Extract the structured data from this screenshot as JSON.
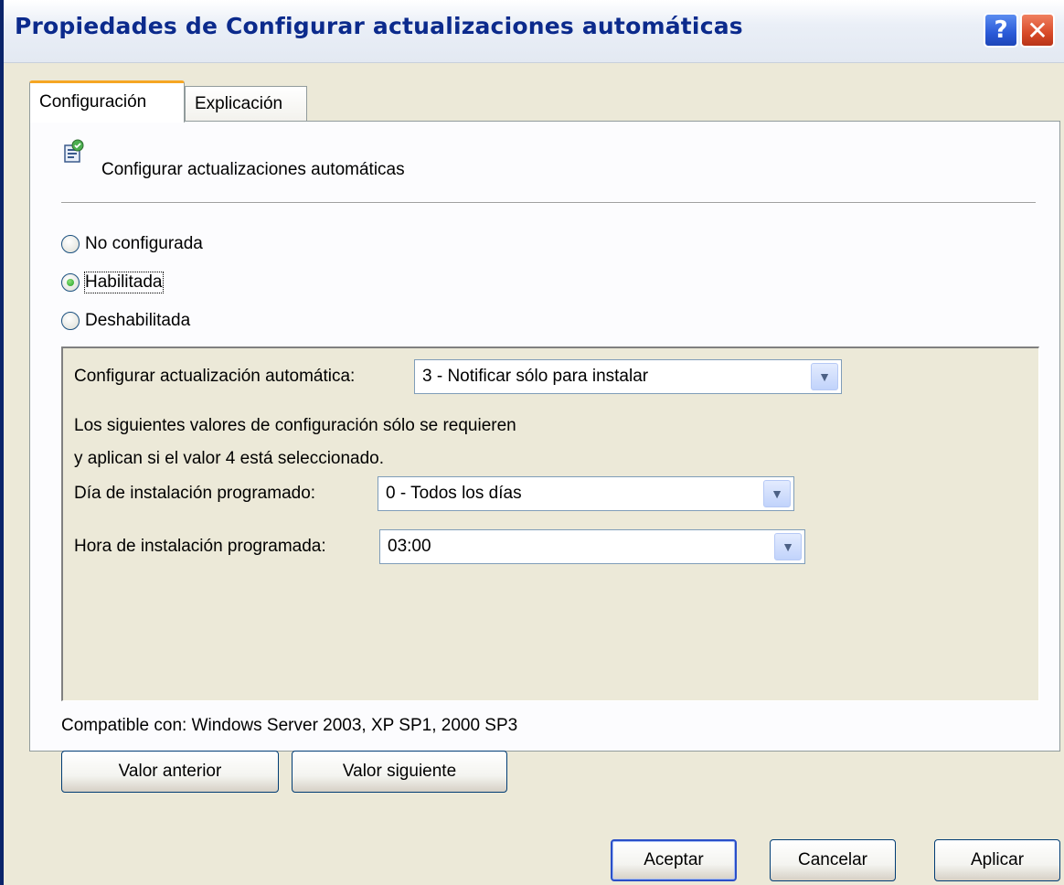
{
  "window": {
    "title": "Propiedades de Configurar actualizaciones automáticas",
    "help_label": "?",
    "close_label": "✕"
  },
  "tabs": [
    {
      "label": "Configuración",
      "active": true
    },
    {
      "label": "Explicación",
      "active": false
    }
  ],
  "policy": {
    "icon": "policy-setting-icon",
    "title": "Configurar actualizaciones automáticas"
  },
  "state_options": [
    {
      "label": "No configurada",
      "checked": false
    },
    {
      "label": "Habilitada",
      "checked": true
    },
    {
      "label": "Deshabilitada",
      "checked": false
    }
  ],
  "options": {
    "auto_update_label": "Configurar actualización automática:",
    "auto_update_value": "3 - Notificar sólo para instalar",
    "note_line1": "Los siguientes valores de configuración sólo se requieren",
    "note_line2": "y aplican si el valor 4 está seleccionado.",
    "day_label": "Día de instalación programado:",
    "day_value": "0 - Todos los días",
    "hour_label": "Hora de instalación programada:",
    "hour_value": "03:00"
  },
  "compatibility": "Compatible con: Windows Server 2003, XP SP1, 2000 SP3",
  "nav_buttons": {
    "previous": "Valor anterior",
    "next": "Valor siguiente"
  },
  "footer_buttons": {
    "ok": "Aceptar",
    "cancel": "Cancelar",
    "apply": "Aplicar"
  },
  "colors": {
    "title_text": "#0B2A8C",
    "window_bg": "#ECE9D8",
    "tab_highlight": "#F5A623"
  }
}
